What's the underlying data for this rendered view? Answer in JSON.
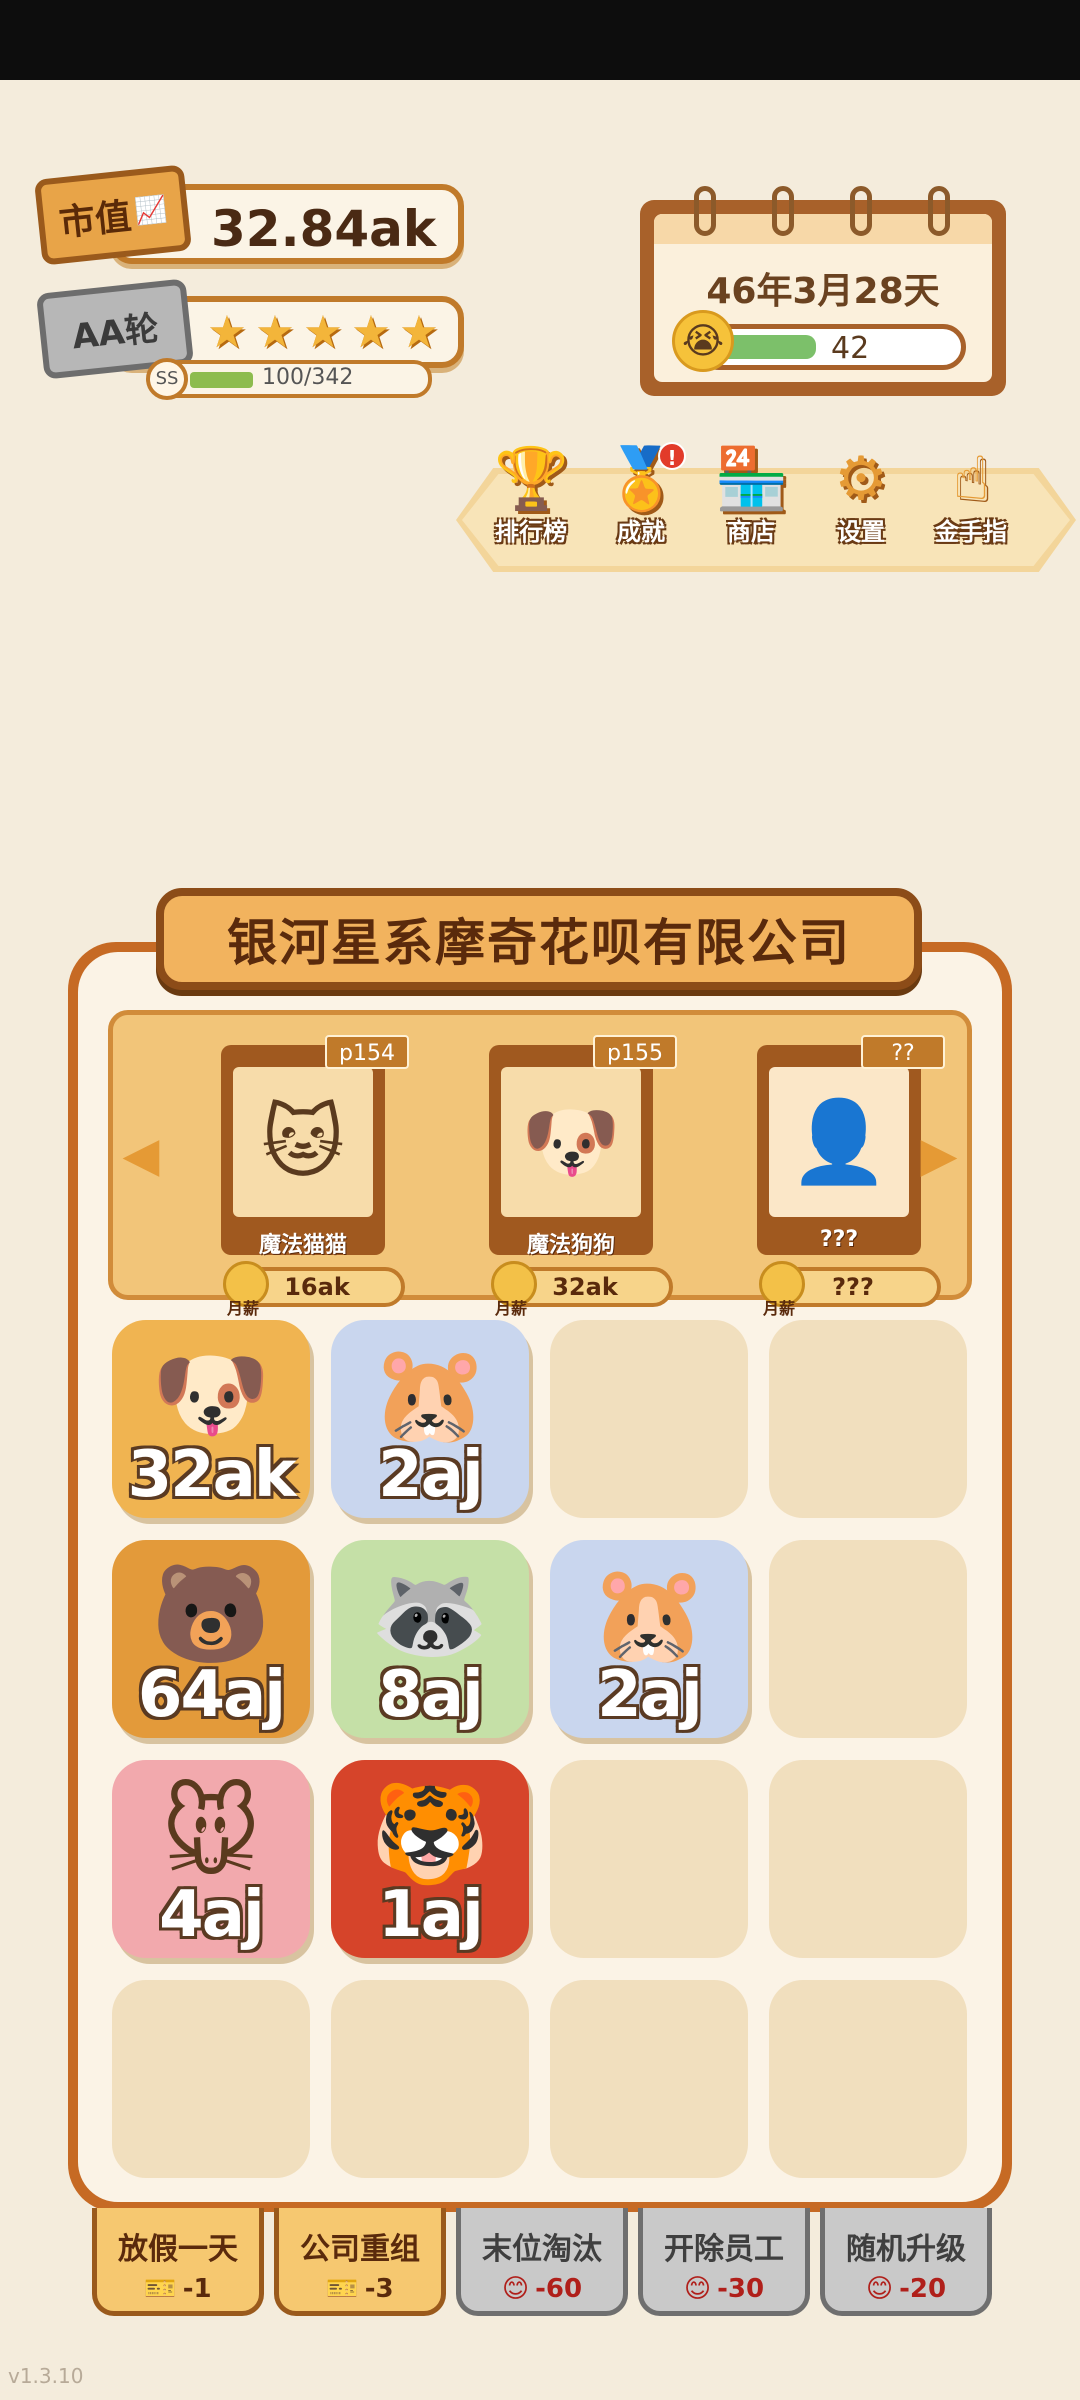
{
  "hud": {
    "market_label": "市值",
    "market_value": "32.84ak",
    "round_label": "AA轮",
    "stars": 5,
    "exp_grade": "SS",
    "exp_text": "100/342",
    "exp_fraction": 0.29
  },
  "calendar": {
    "date": "46年3月28天",
    "mood_value": "42",
    "mood_fraction": 0.42
  },
  "menu": [
    {
      "label": "排行榜",
      "icon": "trophy-icon",
      "glyph": "🏆"
    },
    {
      "label": "成就",
      "icon": "medal-icon",
      "glyph": "🏅",
      "alert": "!"
    },
    {
      "label": "商店",
      "icon": "shop-icon",
      "glyph": "🏪"
    },
    {
      "label": "设置",
      "icon": "gear-icon",
      "glyph": "⚙"
    },
    {
      "label": "金手指",
      "icon": "pointing-hand-icon",
      "glyph": "☝"
    }
  ],
  "company": {
    "name": "银河星系摩奇花呗有限公司"
  },
  "carousel": [
    {
      "tag": "p154",
      "name": "魔法猫猫",
      "price": "16ak",
      "coin_label": "月薪",
      "glyph": "🐱"
    },
    {
      "tag": "p155",
      "name": "魔法狗狗",
      "price": "32ak",
      "coin_label": "月薪",
      "glyph": "🐶"
    },
    {
      "tag": "??",
      "name": "???",
      "price": "???",
      "coin_label": "月薪",
      "glyph": "👤"
    }
  ],
  "grid": [
    {
      "level": "32ak",
      "glyph": "🐶",
      "bg": "#f0b451"
    },
    {
      "level": "2aj",
      "glyph": "🐹",
      "bg": "#c9d6ee"
    },
    {
      "level": "",
      "glyph": "",
      "bg": ""
    },
    {
      "level": "",
      "glyph": "",
      "bg": ""
    },
    {
      "level": "64aj",
      "glyph": "🐻",
      "bg": "#e39a3a"
    },
    {
      "level": "8aj",
      "glyph": "🦝",
      "bg": "#c5e0a7"
    },
    {
      "level": "2aj",
      "glyph": "🐹",
      "bg": "#c9d6ee"
    },
    {
      "level": "",
      "glyph": "",
      "bg": ""
    },
    {
      "level": "4aj",
      "glyph": "🐭",
      "bg": "#f2a9ad"
    },
    {
      "level": "1aj",
      "glyph": "🐯",
      "bg": "#d6442a"
    },
    {
      "level": "",
      "glyph": "",
      "bg": ""
    },
    {
      "level": "",
      "glyph": "",
      "bg": ""
    },
    {
      "level": "",
      "glyph": "",
      "bg": ""
    },
    {
      "level": "",
      "glyph": "",
      "bg": ""
    },
    {
      "level": "",
      "glyph": "",
      "bg": ""
    },
    {
      "level": "",
      "glyph": "",
      "bg": ""
    }
  ],
  "actions": [
    {
      "title": "放假一天",
      "cost": "-1",
      "cost_icon": "ticket-icon",
      "cost_glyph": "🎫",
      "style": "gold"
    },
    {
      "title": "公司重组",
      "cost": "-3",
      "cost_icon": "ticket-icon",
      "cost_glyph": "🎫",
      "style": "gold"
    },
    {
      "title": "末位淘汰",
      "cost": "-60",
      "cost_icon": "smile-icon",
      "cost_glyph": "😊",
      "style": "grey"
    },
    {
      "title": "开除员工",
      "cost": "-30",
      "cost_icon": "smile-icon",
      "cost_glyph": "😊",
      "style": "grey"
    },
    {
      "title": "随机升级",
      "cost": "-20",
      "cost_icon": "smile-icon",
      "cost_glyph": "😊",
      "style": "grey"
    }
  ],
  "version": "v1.3.10",
  "colors": {
    "accent": "#c07a2a",
    "background": "#f4ecdc",
    "good": "#7cc06a",
    "cost_red": "#b01f1a"
  }
}
